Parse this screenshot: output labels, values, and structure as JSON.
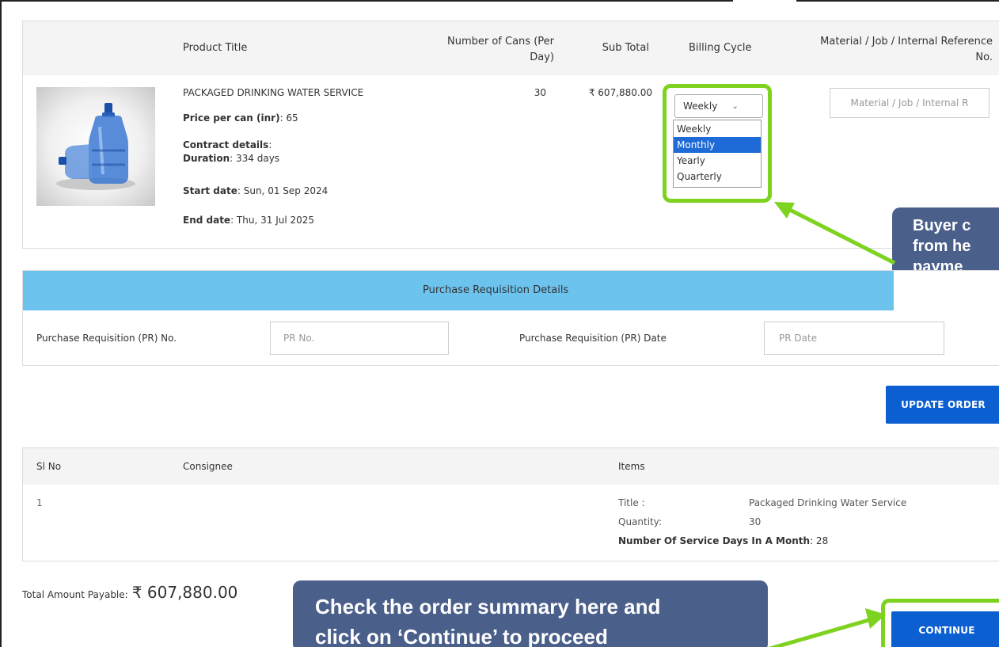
{
  "product_table": {
    "headers": {
      "product_title": "Product Title",
      "cans_line1": "Number of Cans (Per",
      "cans_line2": "Day)",
      "sub_total": "Sub Total",
      "billing_cycle": "Billing Cycle",
      "ref_line1": "Material / Job / Internal Reference",
      "ref_line2": "No."
    },
    "row": {
      "product_name": "PACKAGED DRINKING WATER SERVICE",
      "price_label": "Price per can (inr)",
      "price_value": ": 65",
      "contract_label": "Contract details",
      "contract_colon": ":",
      "duration_label": "Duration",
      "duration_value": ": 334 days",
      "start_label": "Start date",
      "start_value": ": Sun, 01 Sep 2024",
      "end_label": "End date",
      "end_value": ": Thu, 31 Jul 2025",
      "cans": "30",
      "sub_total": "₹ 607,880.00",
      "billing_selected": "Weekly",
      "billing_options": [
        "Weekly",
        "Monthly",
        "Yearly",
        "Quarterly"
      ],
      "billing_highlighted": "Monthly",
      "ref_placeholder": "Material / Job / Internal R"
    }
  },
  "pr_section": {
    "title": "Purchase Requisition Details",
    "pr_no_label": "Purchase Requisition (PR) No.",
    "pr_no_placeholder": "PR No.",
    "pr_date_label": "Purchase Requisition (PR) Date",
    "pr_date_placeholder": "PR Date"
  },
  "update_button": "UPDATE ORDER",
  "consignee_table": {
    "headers": {
      "sl_no": "Sl No",
      "consignee": "Consignee",
      "items": "Items"
    },
    "row": {
      "sl_no": "1",
      "consignee": "",
      "title_label": "Title :",
      "title_value": "Packaged Drinking Water Service",
      "quantity_label": "Quantity:",
      "quantity_value": "30",
      "service_days_label": "Number Of Service Days In A Month",
      "service_days_value": ": 28"
    }
  },
  "total": {
    "label": "Total Amount Payable:",
    "value": "₹ 607,880.00"
  },
  "continue_button": "CONTINUE",
  "callouts": {
    "billing_line1": "Buyer c",
    "billing_line2": "from he",
    "billing_line3": "payme",
    "summary_line1": "Check the order summary here and",
    "summary_line2": "click on ‘Continue’ to proceed"
  },
  "colors": {
    "accent_blue": "#0b5fd0",
    "section_header": "#6cc3ee",
    "highlight_green": "#7ed321",
    "callout_bg": "#4a5f8a"
  }
}
